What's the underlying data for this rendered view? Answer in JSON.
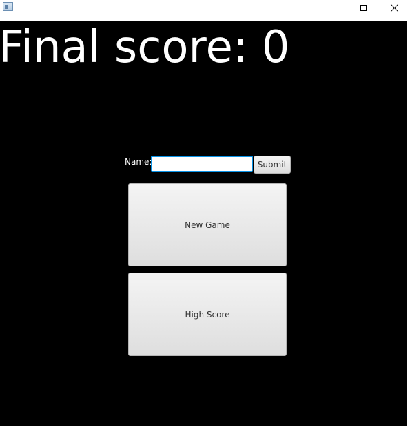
{
  "window": {
    "minimize_icon": "minimize-icon",
    "maximize_icon": "maximize-icon",
    "close_icon": "close-icon"
  },
  "main": {
    "final_score": "Final score: 0",
    "name_label": "Name:",
    "name_value": "",
    "submit_label": "Submit",
    "new_game_label": "New Game",
    "high_score_label": "High Score"
  },
  "colors": {
    "background": "#000000",
    "text": "#ffffff",
    "input_focus_border": "#0a93e6"
  }
}
